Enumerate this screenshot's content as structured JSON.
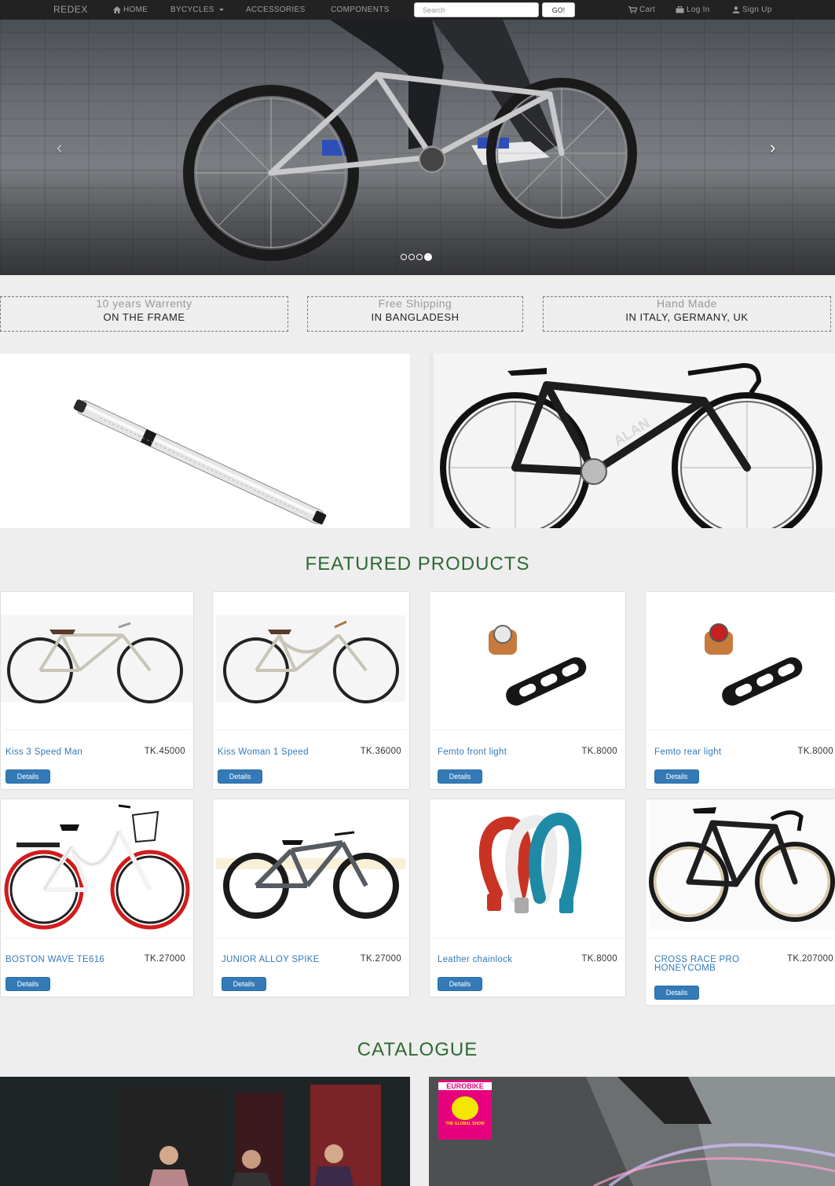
{
  "navbar": {
    "brand": "REDEX",
    "items": [
      {
        "label": "HOME",
        "icon": "home-icon"
      },
      {
        "label": "BYCYCLES",
        "icon": "dropdown-caret"
      },
      {
        "label": "ACCESSORIES"
      },
      {
        "label": "COMPONENTS"
      }
    ],
    "search": {
      "placeholder": "Search",
      "value": ""
    },
    "go_label": "GO!",
    "right": [
      {
        "label": "Cart",
        "icon": "cart-icon"
      },
      {
        "label": "Log In",
        "icon": "briefcase-icon"
      },
      {
        "label": "Sign Up",
        "icon": "user-icon"
      }
    ]
  },
  "carousel": {
    "indicator_count": 4,
    "active_index": 3,
    "prev_glyph": "‹",
    "next_glyph": "›"
  },
  "features": [
    {
      "title": "10 years Warrenty",
      "subtitle": "ON THE FRAME"
    },
    {
      "title": "Free Shipping",
      "subtitle": "IN BANGLADESH"
    },
    {
      "title": "Hand Made",
      "subtitle": "IN ITALY, GERMANY, UK"
    }
  ],
  "promo": {
    "left": {
      "image": "bike-pump"
    },
    "right": {
      "image": "road-bike",
      "frame_text": "ALAN"
    }
  },
  "featured": {
    "heading": "FEATURED PRODUCTS",
    "details_label": "Details",
    "products": [
      {
        "name": "Kiss 3 Speed Man",
        "price": "TK.45000",
        "image": "city-bike"
      },
      {
        "name": "Kiss Woman 1 Speed",
        "price": "TK.36000",
        "image": "womens-city-bike"
      },
      {
        "name": "Femto front light",
        "price": "TK.8000",
        "image": "front-light"
      },
      {
        "name": "Femto rear light",
        "price": "TK.8000",
        "image": "rear-light"
      },
      {
        "name": "BOSTON WAVE TE616",
        "price": "TK.27000",
        "image": "basket-bike"
      },
      {
        "name": "JUNIOR ALLOY SPIKE",
        "price": "TK.27000",
        "image": "mountain-bike"
      },
      {
        "name": "Leather chainlock",
        "price": "TK.8000",
        "image": "chain-locks"
      },
      {
        "name": "CROSS RACE PRO HONEYCOMB",
        "price": "TK.207000",
        "image": "cyclocross-bike"
      }
    ]
  },
  "catalogue": {
    "heading": "CATALOGUE",
    "badge": {
      "line1": "EUROBIKE",
      "line2": "THE GLOBAL SHOW"
    }
  },
  "colors": {
    "navbar_bg": "#222222",
    "heading_green": "#2e6a33",
    "link_blue": "#337ab7",
    "page_bg": "#eeeeee"
  }
}
